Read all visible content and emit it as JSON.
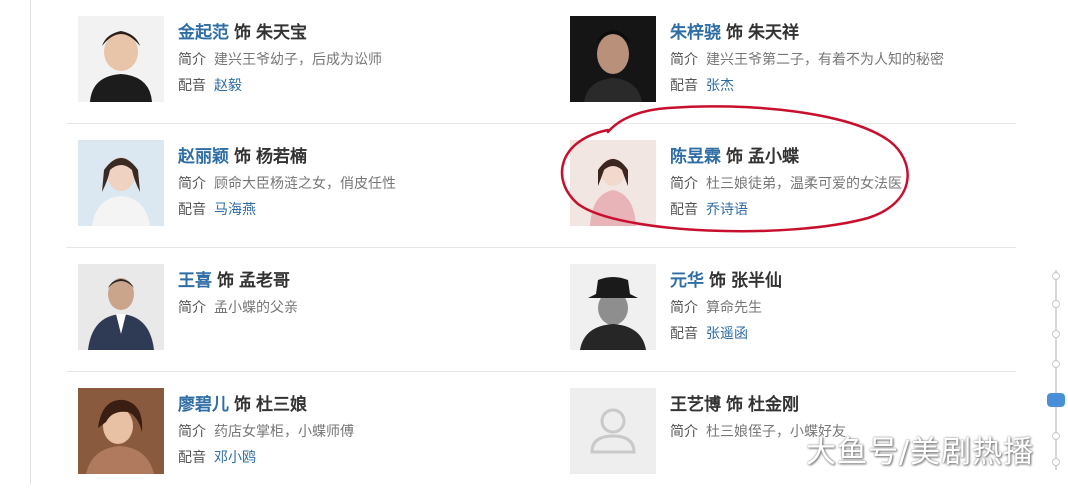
{
  "labels": {
    "role_word": "饰",
    "intro": "简介",
    "voice": "配音"
  },
  "cast": [
    [
      {
        "actor": "金起范",
        "role": "朱天宝",
        "intro": "建兴王爷幼子，后成为讼师",
        "voice": "赵毅",
        "photo_icon": "actor-photo"
      },
      {
        "actor": "朱梓骁",
        "role": "朱天祥",
        "intro": "建兴王爷第二子，有着不为人知的秘密",
        "voice": "张杰",
        "photo_icon": "actor-photo"
      }
    ],
    [
      {
        "actor": "赵丽颖",
        "role": "杨若楠",
        "intro": "顾命大臣杨涟之女，俏皮任性",
        "voice": "马海燕",
        "photo_icon": "actor-photo"
      },
      {
        "actor": "陈昱霖",
        "role": "孟小蝶",
        "intro": "杜三娘徒弟，温柔可爱的女法医",
        "voice": "乔诗语",
        "photo_icon": "actor-photo"
      }
    ],
    [
      {
        "actor": "王喜",
        "role": "孟老哥",
        "intro": "孟小蝶的父亲",
        "voice": "",
        "photo_icon": "actor-photo"
      },
      {
        "actor": "元华",
        "role": "张半仙",
        "intro": "算命先生",
        "voice": "张遥函",
        "photo_icon": "actor-photo"
      }
    ],
    [
      {
        "actor": "廖碧儿",
        "role": "杜三娘",
        "intro": "药店女掌柜，小蝶师傅",
        "voice": "邓小鸥",
        "photo_icon": "actor-photo"
      },
      {
        "actor": "王艺博",
        "role": "杜金刚",
        "intro": "杜三娘侄子，小蝶好友",
        "voice": "",
        "photo_icon": "default-avatar-icon"
      }
    ]
  ],
  "watermark": "大鱼号/美剧热播",
  "colors": {
    "link": "#2f6ea5",
    "annotation": "#c8102e",
    "accent": "#4a90d9"
  }
}
